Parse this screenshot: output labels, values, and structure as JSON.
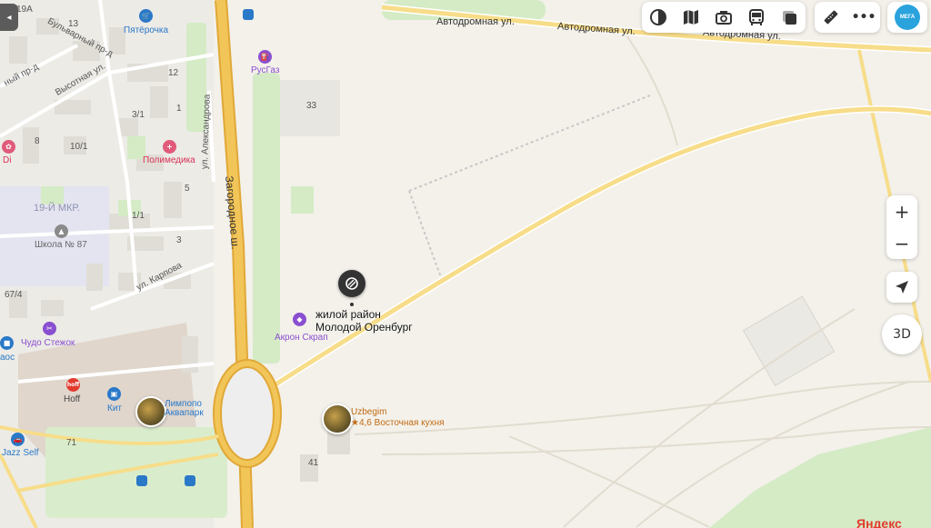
{
  "map": {
    "roads": {
      "avtodromnaya_1": "Автодромная ул.",
      "avtodromnaya_2": "Автодромная ул.",
      "avtodromnaya_3": "Автодромная ул.",
      "zagorodnoe": "Загородное ш.",
      "aleksandrova": "ул. Александрова",
      "karpova": "ул. Карпова",
      "vysotnaya": "Высотная ул.",
      "bulvarny": "Бульварный пр-д",
      "ny_prd": "ный пр-д"
    },
    "house_numbers": [
      "19А",
      "13",
      "12",
      "3/1",
      "10/1",
      "8",
      "1/1",
      "3",
      "5",
      "1",
      "67/4",
      "71",
      "41",
      "33"
    ],
    "districts": {
      "mkr19": "19-Й МКР."
    },
    "pois": {
      "pyaterochka": "Пятёрочка",
      "rusgaz": "РусГаз",
      "polimedika": "Полимедика",
      "di": "Di",
      "school87": "Школа № 87",
      "chudo": "Чудо Стежок",
      "aos": "аос",
      "hoff": "Hoff",
      "kit": "Кит",
      "limpopo": "Лимпопо Аквапарк",
      "jazz": "Jazz Self",
      "akron": "Акрон Скрап",
      "uzbegim": "Uzbegim",
      "uzbegim_rating": "★4,6 Восточная кухня"
    },
    "main_marker": {
      "line1": "жилой район",
      "line2": "Молодой Оренбург"
    },
    "watermark": "Яндекс"
  },
  "toolbar": {
    "icons": [
      "layers-icon",
      "map-mode-icon",
      "panorama-icon",
      "transport-icon",
      "overlay-icon"
    ],
    "secondary_icons": [
      "ruler-icon",
      "more-icon"
    ],
    "more_label": "•••",
    "app_label": "МЕГА"
  },
  "controls": {
    "zoom_in": "+",
    "zoom_out": "−",
    "three_d": "3D"
  },
  "sidebar_toggle": "◂",
  "colors": {
    "land": "#f3f1ea",
    "highway": "#f2c558",
    "highway_edge": "#e0a838",
    "green": "#cfeac0",
    "building": "#e5e1da",
    "water": "#cfe2f3",
    "accent_pink": "#d93256",
    "accent_purple": "#8a4fd0",
    "accent_blue": "#2a78c8",
    "accent_orange": "#c26a14"
  }
}
